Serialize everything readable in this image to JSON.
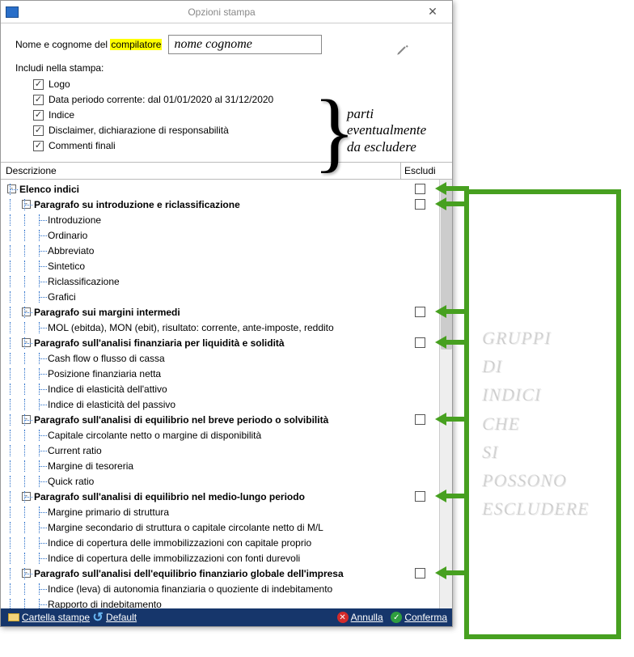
{
  "window": {
    "title": "Opzioni stampa"
  },
  "top": {
    "name_label_pre": "Nome e cognome del ",
    "name_label_hl": "compilatore",
    "name_value": "nome cognome",
    "include_label": "Includi nella stampa:",
    "checks": [
      {
        "label": "Logo",
        "checked": true
      },
      {
        "label": "Data periodo corrente: dal 01/01/2020 al 31/12/2020",
        "checked": true
      },
      {
        "label": "Indice",
        "checked": true
      },
      {
        "label": "Disclaimer, dichiarazione di responsabilità",
        "checked": true
      },
      {
        "label": "Commenti finali",
        "checked": true
      }
    ]
  },
  "grid": {
    "header_desc": "Descrizione",
    "header_excl": "Escludi"
  },
  "tree": [
    {
      "lvl": 0,
      "exp": "-",
      "bold": true,
      "text": "Elenco indici",
      "cb": true
    },
    {
      "lvl": 1,
      "exp": "-",
      "bold": true,
      "text": "Paragrafo su introduzione e riclassificazione",
      "cb": true
    },
    {
      "lvl": 2,
      "exp": "",
      "bold": false,
      "text": "Introduzione",
      "cb": false
    },
    {
      "lvl": 2,
      "exp": "",
      "bold": false,
      "text": "Ordinario",
      "cb": false
    },
    {
      "lvl": 2,
      "exp": "",
      "bold": false,
      "text": "Abbreviato",
      "cb": false
    },
    {
      "lvl": 2,
      "exp": "",
      "bold": false,
      "text": "Sintetico",
      "cb": false
    },
    {
      "lvl": 2,
      "exp": "",
      "bold": false,
      "text": "Riclassificazione",
      "cb": false
    },
    {
      "lvl": 2,
      "exp": "",
      "bold": false,
      "text": "Grafici",
      "cb": false
    },
    {
      "lvl": 1,
      "exp": "-",
      "bold": true,
      "text": "Paragrafo sui margini intermedi",
      "cb": true
    },
    {
      "lvl": 2,
      "exp": "",
      "bold": false,
      "text": "MOL (ebitda), MON (ebit), risultato: corrente, ante-imposte, reddito",
      "cb": false
    },
    {
      "lvl": 1,
      "exp": "-",
      "bold": true,
      "text": "Paragrafo sull'analisi finanziaria per liquidità e solidità",
      "cb": true
    },
    {
      "lvl": 2,
      "exp": "",
      "bold": false,
      "text": "Cash flow o flusso di cassa",
      "cb": false
    },
    {
      "lvl": 2,
      "exp": "",
      "bold": false,
      "text": "Posizione finanziaria netta",
      "cb": false
    },
    {
      "lvl": 2,
      "exp": "",
      "bold": false,
      "text": "Indice di elasticità dell'attivo",
      "cb": false
    },
    {
      "lvl": 2,
      "exp": "",
      "bold": false,
      "text": "Indice di elasticità del passivo",
      "cb": false
    },
    {
      "lvl": 1,
      "exp": "-",
      "bold": true,
      "text": "Paragrafo sull'analisi di equilibrio nel breve periodo o solvibilità",
      "cb": true
    },
    {
      "lvl": 2,
      "exp": "",
      "bold": false,
      "text": "Capitale circolante netto o margine di disponibilità",
      "cb": false
    },
    {
      "lvl": 2,
      "exp": "",
      "bold": false,
      "text": "Current ratio",
      "cb": false
    },
    {
      "lvl": 2,
      "exp": "",
      "bold": false,
      "text": "Margine di tesoreria",
      "cb": false
    },
    {
      "lvl": 2,
      "exp": "",
      "bold": false,
      "text": "Quick ratio",
      "cb": false
    },
    {
      "lvl": 1,
      "exp": "-",
      "bold": true,
      "text": "Paragrafo sull'analisi di equilibrio nel medio-lungo periodo",
      "cb": true
    },
    {
      "lvl": 2,
      "exp": "",
      "bold": false,
      "text": "Margine primario di struttura",
      "cb": false
    },
    {
      "lvl": 2,
      "exp": "",
      "bold": false,
      "text": "Margine secondario di struttura o capitale circolante netto di M/L",
      "cb": false
    },
    {
      "lvl": 2,
      "exp": "",
      "bold": false,
      "text": "Indice di copertura delle immobilizzazioni con capitale proprio",
      "cb": false
    },
    {
      "lvl": 2,
      "exp": "",
      "bold": false,
      "text": "Indice di copertura delle immobilizzazioni con fonti durevoli",
      "cb": false
    },
    {
      "lvl": 1,
      "exp": "-",
      "bold": true,
      "text": "Paragrafo sull'analisi dell'equilibrio finanziario globale dell'impresa",
      "cb": true
    },
    {
      "lvl": 2,
      "exp": "",
      "bold": false,
      "text": "Indice (leva) di autonomia finanziaria o quoziente di indebitamento",
      "cb": false
    },
    {
      "lvl": 2,
      "exp": "",
      "bold": false,
      "text": "Rapporto di indebitamento",
      "cb": false
    }
  ],
  "footer": {
    "folder": "Cartella stampe",
    "def": "Default",
    "cancel": "Annulla",
    "confirm": "Conferma"
  },
  "annotations": {
    "parts": "parti\neventualmente\nda escludere",
    "green": "GRUPPI\nDI\nINDICI\nCHE\nSI\nPOSSONO\nESCLUDERE"
  }
}
